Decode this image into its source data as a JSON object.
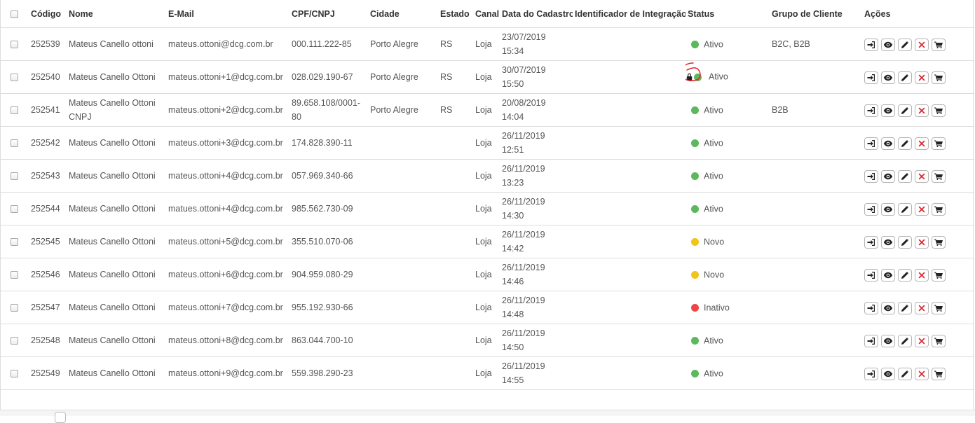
{
  "table": {
    "headers": {
      "codigo": "Código",
      "nome": "Nome",
      "email": "E-Mail",
      "cpf": "CPF/CNPJ",
      "cidade": "Cidade",
      "estado": "Estado",
      "canal": "Canal",
      "data": "Data do Cadastro",
      "identificador": "Identificador de Integração",
      "status": "Status",
      "grupo": "Grupo de Cliente",
      "acoes": "Ações"
    },
    "rows": [
      {
        "codigo": "252539",
        "nome": "Mateus Canello ottoni",
        "email": "mateus.ottoni@dcg.com.br",
        "cpf": "000.111.222-85",
        "cidade": "Porto Alegre",
        "estado": "RS",
        "canal": "Loja",
        "data": "23/07/2019",
        "hora": "15:34",
        "identificador": "",
        "status": "Ativo",
        "status_color": "green",
        "grupo": "B2C, B2B",
        "locked": false
      },
      {
        "codigo": "252540",
        "nome": "Mateus Canello Ottoni",
        "email": "mateus.ottoni+1@dcg.com.br",
        "cpf": "028.029.190-67",
        "cidade": "Porto Alegre",
        "estado": "RS",
        "canal": "Loja",
        "data": "30/07/2019",
        "hora": "15:50",
        "identificador": "",
        "status": "Ativo",
        "status_color": "green",
        "grupo": "",
        "locked": true
      },
      {
        "codigo": "252541",
        "nome": "Mateus Canello Ottoni CNPJ",
        "email": "mateus.ottoni+2@dcg.com.br",
        "cpf": "89.658.108/0001-80",
        "cidade": "Porto Alegre",
        "estado": "RS",
        "canal": "Loja",
        "data": "20/08/2019",
        "hora": "14:04",
        "identificador": "",
        "status": "Ativo",
        "status_color": "green",
        "grupo": "B2B",
        "locked": false
      },
      {
        "codigo": "252542",
        "nome": "Mateus Canello Ottoni",
        "email": "mateus.ottoni+3@dcg.com.br",
        "cpf": "174.828.390-11",
        "cidade": "",
        "estado": "",
        "canal": "Loja",
        "data": "26/11/2019",
        "hora": "12:51",
        "identificador": "",
        "status": "Ativo",
        "status_color": "green",
        "grupo": "",
        "locked": false
      },
      {
        "codigo": "252543",
        "nome": "Mateus Canello Ottoni",
        "email": "mateus.ottoni+4@dcg.com.br",
        "cpf": "057.969.340-66",
        "cidade": "",
        "estado": "",
        "canal": "Loja",
        "data": "26/11/2019",
        "hora": "13:23",
        "identificador": "",
        "status": "Ativo",
        "status_color": "green",
        "grupo": "",
        "locked": false
      },
      {
        "codigo": "252544",
        "nome": "Mateus Canello Ottoni",
        "email": "matues.ottoni+4@dcg.com.br",
        "cpf": "985.562.730-09",
        "cidade": "",
        "estado": "",
        "canal": "Loja",
        "data": "26/11/2019",
        "hora": "14:30",
        "identificador": "",
        "status": "Ativo",
        "status_color": "green",
        "grupo": "",
        "locked": false
      },
      {
        "codigo": "252545",
        "nome": "Mateus Canello Ottoni",
        "email": "mateus.ottoni+5@dcg.com.br",
        "cpf": "355.510.070-06",
        "cidade": "",
        "estado": "",
        "canal": "Loja",
        "data": "26/11/2019",
        "hora": "14:42",
        "identificador": "",
        "status": "Novo",
        "status_color": "yellow",
        "grupo": "",
        "locked": false
      },
      {
        "codigo": "252546",
        "nome": "Mateus Canello Ottoni",
        "email": "mateus.ottoni+6@dcg.com.br",
        "cpf": "904.959.080-29",
        "cidade": "",
        "estado": "",
        "canal": "Loja",
        "data": "26/11/2019",
        "hora": "14:46",
        "identificador": "",
        "status": "Novo",
        "status_color": "yellow",
        "grupo": "",
        "locked": false
      },
      {
        "codigo": "252547",
        "nome": "Mateus Canello Ottoni",
        "email": "mateus.ottoni+7@dcg.com.br",
        "cpf": "955.192.930-66",
        "cidade": "",
        "estado": "",
        "canal": "Loja",
        "data": "26/11/2019",
        "hora": "14:48",
        "identificador": "",
        "status": "Inativo",
        "status_color": "red",
        "grupo": "",
        "locked": false
      },
      {
        "codigo": "252548",
        "nome": "Mateus Canello Ottoni",
        "email": "mateus.ottoni+8@dcg.com.br",
        "cpf": "863.044.700-10",
        "cidade": "",
        "estado": "",
        "canal": "Loja",
        "data": "26/11/2019",
        "hora": "14:50",
        "identificador": "",
        "status": "Ativo",
        "status_color": "green",
        "grupo": "",
        "locked": false
      },
      {
        "codigo": "252549",
        "nome": "Mateus Canello Ottoni",
        "email": "mateus.ottoni+9@dcg.com.br",
        "cpf": "559.398.290-23",
        "cidade": "",
        "estado": "",
        "canal": "Loja",
        "data": "26/11/2019",
        "hora": "14:55",
        "identificador": "",
        "status": "Ativo",
        "status_color": "green",
        "grupo": "",
        "locked": false
      }
    ],
    "actions": [
      {
        "name": "login-button",
        "icon": "sign-in-icon"
      },
      {
        "name": "view-button",
        "icon": "eye-icon"
      },
      {
        "name": "edit-button",
        "icon": "pencil-icon"
      },
      {
        "name": "delete-button",
        "icon": "close-icon"
      },
      {
        "name": "cart-button",
        "icon": "shopping-cart-icon"
      }
    ]
  },
  "colors": {
    "green": "#5cb85c",
    "yellow": "#f0c419",
    "red": "#f04545",
    "delete": "#d9282f",
    "annotation": "#e8232b"
  }
}
